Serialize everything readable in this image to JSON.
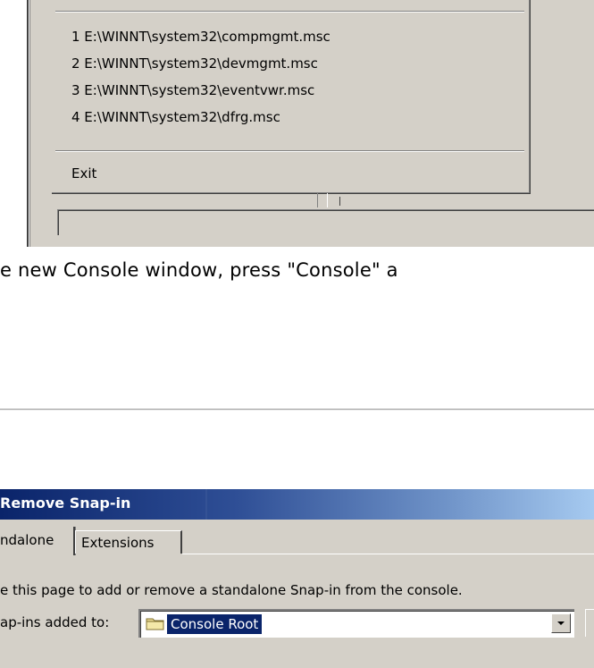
{
  "console_menu": {
    "recent_files": [
      "1 E:\\WINNT\\system32\\compmgmt.msc",
      "2 E:\\WINNT\\system32\\devmgmt.msc",
      "3 E:\\WINNT\\system32\\eventvwr.msc",
      "4 E:\\WINNT\\system32\\dfrg.msc"
    ],
    "exit_label": "Exit"
  },
  "instruction_text": "e new Console window, press \"Console\" a",
  "dialog": {
    "title": "Remove Snap-in",
    "tabs": [
      "ndalone",
      "Extensions"
    ],
    "description": "e this page to add or remove a standalone Snap-in from the console.",
    "snapin_label": "ap-ins added to:",
    "combo_value": "Console Root"
  },
  "colors": {
    "face": "#d4d0c8",
    "title_dark": "#0a246a",
    "title_light": "#a6caf0",
    "selection": "#0a246a"
  }
}
